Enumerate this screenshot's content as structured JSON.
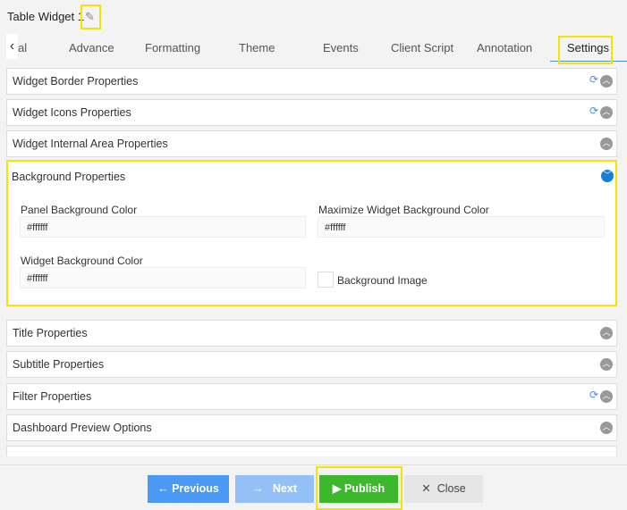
{
  "header": {
    "title": "Table Widget 1",
    "edit_icon": "edit-icon"
  },
  "tabs": [
    {
      "label": "al"
    },
    {
      "label": "Advance"
    },
    {
      "label": "Formatting"
    },
    {
      "label": "Theme"
    },
    {
      "label": "Events"
    },
    {
      "label": "Client Script"
    },
    {
      "label": "Annotation"
    },
    {
      "label": "Settings",
      "active": true
    }
  ],
  "panels": {
    "border": "Widget Border Properties",
    "icons": "Widget Icons Properties",
    "internal": "Widget Internal Area Properties",
    "background": {
      "title": "Background Properties",
      "panel_bg_label": "Panel Background Color",
      "panel_bg_value": "#ffffff",
      "max_bg_label": "Maximize Widget Background Color",
      "max_bg_value": "#ffffff",
      "widget_bg_label": "Widget Background Color",
      "widget_bg_value": "#ffffff",
      "bg_image_label": "Background Image",
      "bg_image_checked": false
    },
    "title": "Title Properties",
    "subtitle": "Subtitle Properties",
    "filter": "Filter Properties",
    "preview": "Dashboard Preview Options"
  },
  "footer": {
    "previous": "Previous",
    "next": "Next",
    "publish": "Publish",
    "close": "Close"
  },
  "colors": {
    "highlight": "#f5e400",
    "primary": "#4a9af5",
    "publish": "#3cb82c",
    "accent": "#1a7fd4"
  }
}
